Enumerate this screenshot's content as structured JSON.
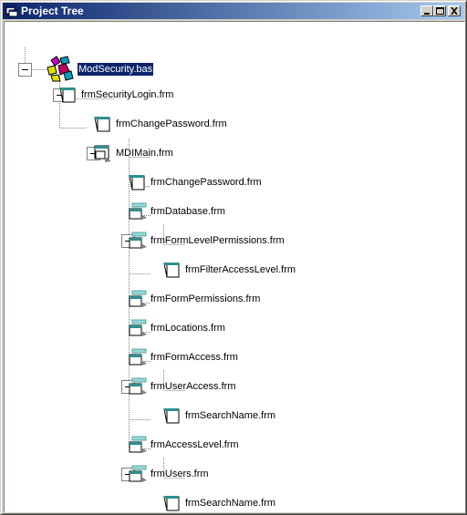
{
  "window": {
    "title": "Project Tree",
    "icons": {
      "title": "project-tree-icon",
      "minimize": "minimize-icon",
      "maximize": "maximize-icon",
      "close": "close-icon"
    }
  },
  "tree": {
    "nodes": [
      {
        "label": "ModSecurity.bas",
        "icon": "module-icon",
        "selected": true,
        "expanded": true
      },
      {
        "label": "frmSecurityLogin.frm",
        "icon": "form-icon",
        "expanded": true
      },
      {
        "label": "frmChangePassword.frm",
        "icon": "form-icon"
      },
      {
        "label": "MDIMain.frm",
        "icon": "mdi-form-icon",
        "expanded": true
      },
      {
        "label": "frmChangePassword.frm",
        "icon": "form-icon"
      },
      {
        "label": "frmDatabase.frm",
        "icon": "mdi-child-form-icon"
      },
      {
        "label": "frmFormLevelPermissions.frm",
        "icon": "mdi-child-form-icon",
        "expanded": true
      },
      {
        "label": "frmFilterAccessLevel.frm",
        "icon": "form-icon"
      },
      {
        "label": "frmFormPermissions.frm",
        "icon": "mdi-child-form-icon"
      },
      {
        "label": "frmLocations.frm",
        "icon": "mdi-child-form-icon"
      },
      {
        "label": "frmFormAccess.frm",
        "icon": "mdi-child-form-icon"
      },
      {
        "label": "frmUserAccess.frm",
        "icon": "mdi-child-form-icon",
        "expanded": true
      },
      {
        "label": "frmSearchName.frm",
        "icon": "form-icon"
      },
      {
        "label": "frmAccessLevel.frm",
        "icon": "mdi-child-form-icon"
      },
      {
        "label": "frmUsers.frm",
        "icon": "mdi-child-form-icon",
        "expanded": true
      },
      {
        "label": "frmSearchName.frm",
        "icon": "form-icon"
      }
    ]
  }
}
